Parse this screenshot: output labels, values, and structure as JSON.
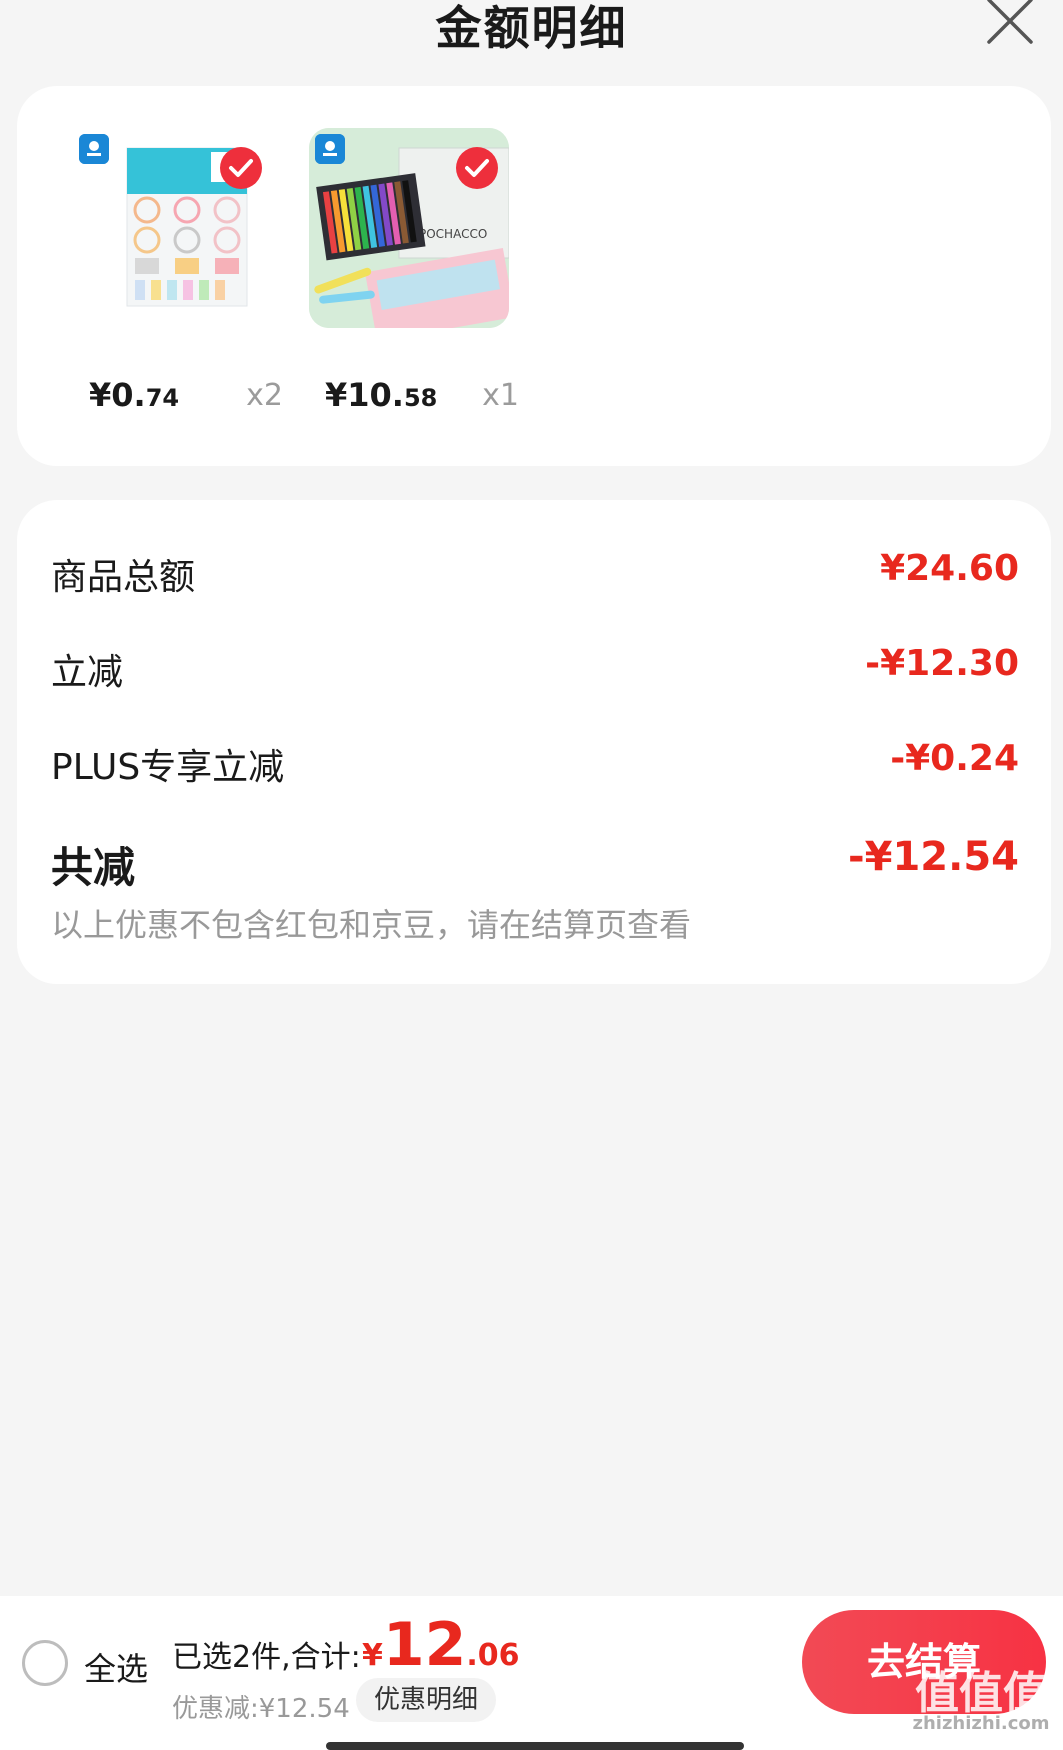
{
  "header": {
    "title": "金额明细"
  },
  "products": [
    {
      "price_main": "¥0.",
      "price_small": "74",
      "qty": "x2"
    },
    {
      "price_main": "¥10.",
      "price_small": "58",
      "qty": "x1"
    }
  ],
  "summary": {
    "rows": [
      {
        "label": "商品总额",
        "value": "¥24.60"
      },
      {
        "label": "立减",
        "value": "-¥12.30"
      },
      {
        "label": "PLUS专享立减",
        "value": "-¥0.24"
      }
    ],
    "total_label": "共减",
    "total_value": "-¥12.54",
    "note": "以上优惠不包含红包和京豆，请在结算页查看"
  },
  "bottom": {
    "select_all_label": "全选",
    "selected_text": "已选2件,合计:",
    "total_symbol": "¥",
    "total_int": "12",
    "total_dec": ".06",
    "discount_text": "优惠减:¥12.54",
    "discount_detail_label": "优惠明细",
    "checkout_label": "去结算"
  },
  "watermark": {
    "main": "值值值",
    "sub": "zhizhizhi.com"
  },
  "colors": {
    "accent": "#e8281e",
    "checkout": "#f73243"
  }
}
